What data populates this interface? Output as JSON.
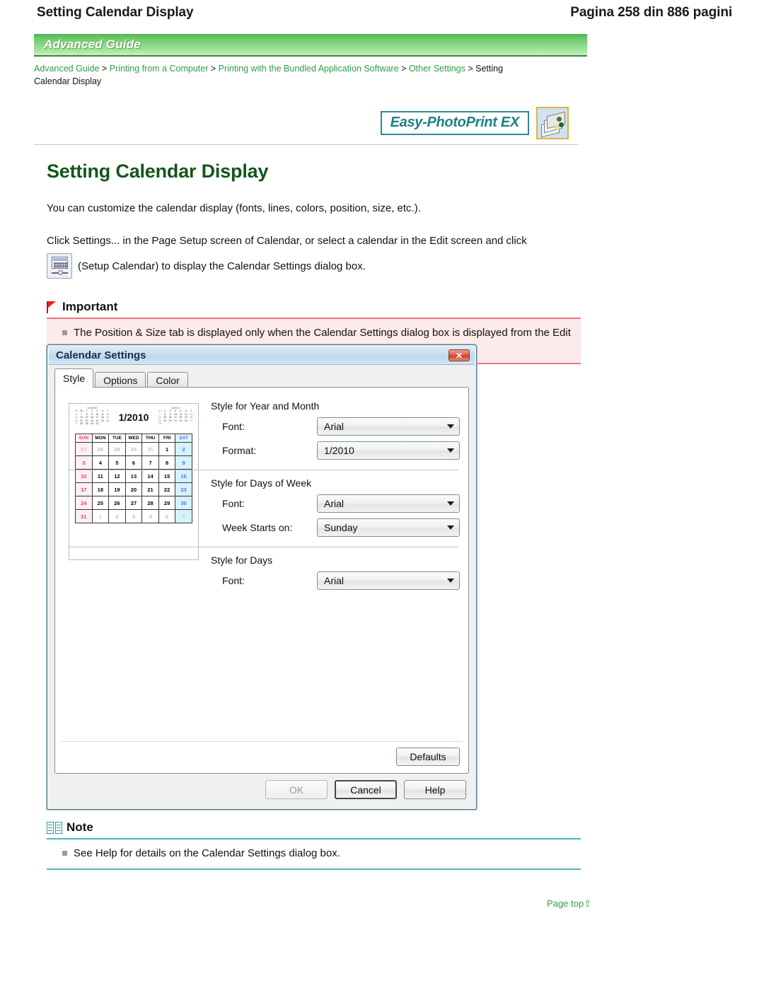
{
  "page_header": {
    "title": "Setting Calendar Display",
    "pages": "Pagina 258 din 886 pagini"
  },
  "banner": {
    "label": "Advanced Guide"
  },
  "breadcrumb": {
    "items": [
      "Advanced Guide",
      "Printing from a Computer",
      "Printing with the Bundled Application Software",
      "Other Settings"
    ],
    "separator": ">",
    "current": "Setting",
    "current_wrap": "Calendar Display"
  },
  "product": {
    "badge": "Easy-PhotoPrint EX",
    "icon": "photo-stack-icon"
  },
  "doc": {
    "title": "Setting Calendar Display",
    "intro": "You can customize the calendar display (fonts, lines, colors, position, size, etc.).",
    "instruction": "Click Settings... in the Page Setup screen of Calendar, or select a calendar in the Edit screen and click",
    "icon_caption": "(Setup Calendar) to display the Calendar Settings dialog box."
  },
  "important": {
    "title": "Important",
    "icon": "red-flag-icon",
    "items": [
      "The Position & Size tab is displayed only when the Calendar Settings dialog box is displayed from the Edit screen."
    ]
  },
  "note": {
    "title": "Note",
    "icon": "open-book-icon",
    "items": [
      "See Help for details on the Calendar Settings dialog box."
    ]
  },
  "page_top": {
    "label": "Page top",
    "arrow": "⇧"
  },
  "dialog": {
    "title": "Calendar Settings",
    "close_label": "✕",
    "tabs": [
      {
        "label": "Style",
        "active": true
      },
      {
        "label": "Options",
        "active": false
      },
      {
        "label": "Color",
        "active": false
      }
    ],
    "preview": {
      "month_title": "1/2010",
      "weekday_headers": [
        "SUN",
        "MON",
        "TUE",
        "WED",
        "THU",
        "FRI",
        "SAT"
      ],
      "weeks": [
        [
          "27",
          "28",
          "29",
          "30",
          "31",
          "1",
          "2"
        ],
        [
          "3",
          "4",
          "5",
          "6",
          "7",
          "8",
          "9"
        ],
        [
          "10",
          "11",
          "12",
          "13",
          "14",
          "15",
          "16"
        ],
        [
          "17",
          "18",
          "19",
          "20",
          "21",
          "22",
          "23"
        ],
        [
          "24",
          "25",
          "26",
          "27",
          "28",
          "29",
          "30"
        ],
        [
          "31",
          "1",
          "2",
          "3",
          "4",
          "5",
          "6"
        ]
      ],
      "outside": [
        [
          true,
          true,
          true,
          true,
          true,
          false,
          false
        ],
        [
          false,
          false,
          false,
          false,
          false,
          false,
          false
        ],
        [
          false,
          false,
          false,
          false,
          false,
          false,
          false
        ],
        [
          false,
          false,
          false,
          false,
          false,
          false,
          false
        ],
        [
          false,
          false,
          false,
          false,
          false,
          false,
          false
        ],
        [
          false,
          true,
          true,
          true,
          true,
          true,
          true
        ]
      ],
      "mini_left_title": "12/2009",
      "mini_right_title": "2/2010"
    },
    "groups": [
      {
        "title": "Style for Year and Month",
        "fields": [
          {
            "label": "Font:",
            "mnemonic": "F",
            "value": "Arial"
          },
          {
            "label": "Format:",
            "mnemonic": "o",
            "value": "1/2010"
          }
        ]
      },
      {
        "title": "Style for Days of Week",
        "fields": [
          {
            "label": "Font:",
            "mnemonic": "t",
            "value": "Arial"
          },
          {
            "label": "Week Starts on:",
            "mnemonic": "W",
            "value": "Sunday"
          }
        ]
      },
      {
        "title": "Style for Days",
        "fields": [
          {
            "label": "Font:",
            "mnemonic": "t",
            "value": "Arial"
          }
        ]
      }
    ],
    "buttons": {
      "defaults": "Defaults",
      "ok": "OK",
      "cancel": "Cancel",
      "help": "Help"
    }
  },
  "colors": {
    "heading_green": "#13571b",
    "link_green": "#2f9e41",
    "banner_green": "#6ec96b",
    "important_red": "#e07a7f",
    "note_teal": "#4fb5ba",
    "badge_teal": "#1f7f86"
  }
}
